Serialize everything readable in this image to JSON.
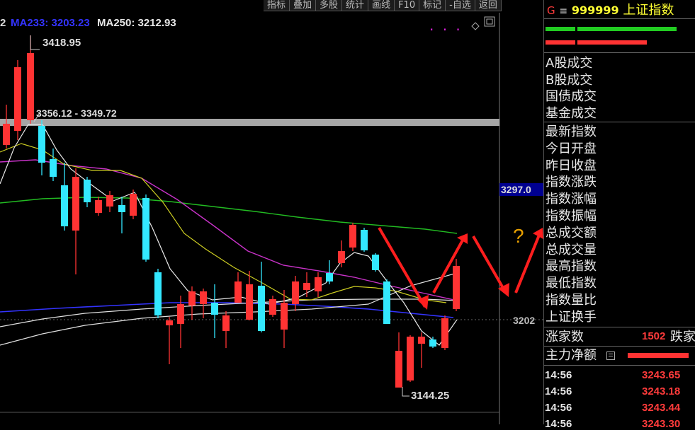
{
  "toolbar": {
    "buttons": [
      "指标",
      "叠加",
      "多股",
      "统计",
      "画线",
      "F10",
      "标记",
      "-自选",
      "返回"
    ]
  },
  "chart": {
    "ma_prefix": "2",
    "ma233": "MA233: 3203.23",
    "ma250": "MA250: 3212.93",
    "high_label": "3418.95",
    "low_label": "3144.25",
    "range_label": "3356.12 - 3349.72",
    "price_tag": "3297.0",
    "axis_label": "3202",
    "question_mark": "?",
    "dots": "· · ·",
    "colors": {
      "up": "#ff3333",
      "down": "#33e8ff",
      "ma250": "#3333ff",
      "ma233": "#e0e0e0"
    }
  },
  "header": {
    "code_prefix": "G",
    "menu_icon": "≡",
    "code": "999999",
    "name": "上证指数"
  },
  "panel": {
    "trade_labels": [
      "A股成交",
      "B股成交",
      "国债成交",
      "基金成交"
    ],
    "index_labels": [
      "最新指数",
      "今日开盘",
      "昨日收盘",
      "指数涨跌",
      "指数涨幅",
      "指数振幅",
      "总成交额",
      "总成交量",
      "最高指数",
      "最低指数",
      "指数量比",
      "上证换手"
    ],
    "advance_label": "涨家数",
    "advance_value": "1502",
    "decline_label": "跌家",
    "main_flow_label": "主力净额",
    "ticks": [
      {
        "time": "14:56",
        "value": "3243.65"
      },
      {
        "time": "14:56",
        "value": "3243.18"
      },
      {
        "time": "14:56",
        "value": "3243.44"
      },
      {
        "time": "14:56",
        "value": "3243.30"
      }
    ]
  }
}
